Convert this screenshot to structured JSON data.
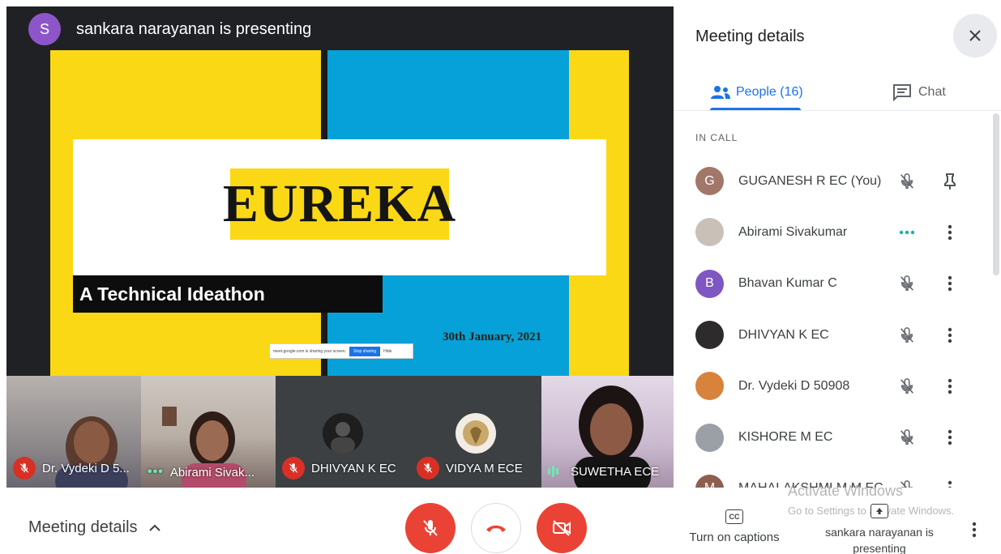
{
  "presenter": {
    "initial": "S",
    "status": "sankara narayanan is presenting"
  },
  "slide": {
    "title": "EUREKA",
    "subtitle": "A Technical Ideathon",
    "date": "30th January, 2021",
    "share_bar_text": "meet.google.com is sharing your screen.",
    "share_bar_stop": "Stop sharing",
    "share_bar_hide": "Hide"
  },
  "tiles": [
    {
      "name": "Dr. Vydeki D 5...",
      "state": "mic-off"
    },
    {
      "name": "Abirami Sivak...",
      "state": "dots"
    },
    {
      "name": "DHIVYAN K EC",
      "state": "mic-off"
    },
    {
      "name": "VIDYA M ECE",
      "state": "mic-off"
    },
    {
      "name": "SUWETHA ECE",
      "state": "speaking"
    }
  ],
  "panel": {
    "title": "Meeting details",
    "tabs": {
      "people": "People (16)",
      "chat": "Chat"
    },
    "section": "IN CALL",
    "people": [
      {
        "initial": "G",
        "name": "GUGANESH R EC (You)",
        "avatar_color": "#a1776a",
        "status": "mic-off",
        "action": "pin"
      },
      {
        "initial": "",
        "name": "Abirami Sivakumar",
        "avatar_color": "#c9c1b7",
        "status": "dots",
        "action": "more"
      },
      {
        "initial": "B",
        "name": "Bhavan Kumar C",
        "avatar_color": "#7e57c2",
        "status": "mic-off",
        "action": "more"
      },
      {
        "initial": "",
        "name": "DHIVYAN K EC",
        "avatar_color": "#2d2b2b",
        "status": "mic-off",
        "action": "more"
      },
      {
        "initial": "",
        "name": "Dr. Vydeki D 50908",
        "avatar_color": "#d9823b",
        "status": "mic-off",
        "action": "more"
      },
      {
        "initial": "",
        "name": "KISHORE M EC",
        "avatar_color": "#9aa0a6",
        "status": "mic-off",
        "action": "more"
      },
      {
        "initial": "M",
        "name": "MAHALAKSHMI M M EC",
        "avatar_color": "#8d5f4f",
        "status": "mic-off",
        "action": "more"
      }
    ]
  },
  "bottom": {
    "meeting_details": "Meeting details",
    "captions_label": "Turn on captions",
    "cc_text": "CC",
    "presenting_label": "sankara narayanan is presenting"
  },
  "watermark": {
    "title": "Activate Windows",
    "subtitle": "Go to Settings to activate Windows."
  }
}
